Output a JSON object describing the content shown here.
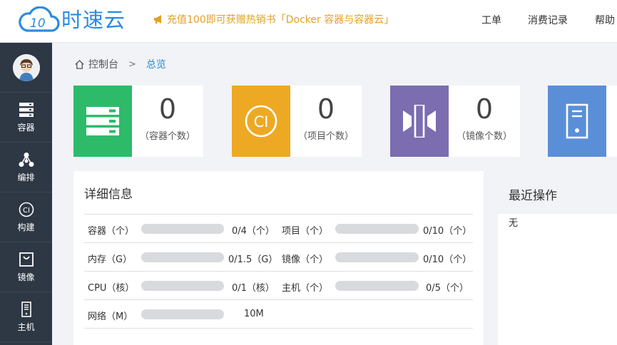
{
  "brand": {
    "name": "时速云"
  },
  "promo": {
    "text": "充值100即可获赠热销书「Docker 容器与容器云」"
  },
  "nav": {
    "items": [
      "工单",
      "消费记录",
      "帮助"
    ]
  },
  "sidebar": {
    "items": [
      {
        "label": "容器",
        "icon": "server-stack-icon"
      },
      {
        "label": "编排",
        "icon": "topology-icon"
      },
      {
        "label": "构建",
        "icon": "ci-icon"
      },
      {
        "label": "镜像",
        "icon": "image-bag-icon"
      },
      {
        "label": "主机",
        "icon": "host-icon"
      }
    ]
  },
  "breadcrumb": {
    "root": "控制台",
    "current": "总览"
  },
  "cards": [
    {
      "value": "0",
      "label": "（容器个数）",
      "color": "#2dbb6a",
      "icon": "server-stack-icon"
    },
    {
      "value": "0",
      "label": "（项目个数）",
      "color": "#eda923",
      "icon": "ci-icon"
    },
    {
      "value": "0",
      "label": "（镜像个数）",
      "color": "#7b6db0",
      "icon": "image-icon"
    },
    {
      "value": "",
      "label": "",
      "color": "#5a8fd8",
      "icon": "host-icon"
    }
  ],
  "details": {
    "title": "详细信息",
    "rows": [
      [
        {
          "label": "容器（个）",
          "value": "0/4（个）",
          "ratio": 0
        },
        {
          "label": "项目（个）",
          "value": "0/10（个）",
          "ratio": 0
        }
      ],
      [
        {
          "label": "内存（G）",
          "value": "0/1.5（G）",
          "ratio": 0
        },
        {
          "label": "镜像（个）",
          "value": "0/10（个）",
          "ratio": 0
        }
      ],
      [
        {
          "label": "CPU（核）",
          "value": "0/1（核）",
          "ratio": 0
        },
        {
          "label": "主机（个）",
          "value": "0/5（个）",
          "ratio": 0
        }
      ],
      [
        {
          "label": "网络（M）",
          "value": "10M",
          "ratio": 0
        }
      ]
    ]
  },
  "recent": {
    "title": "最近操作",
    "empty": "无"
  },
  "colors": {
    "accent": "#2a8be0",
    "promo": "#e2a028",
    "sidebar": "#2e3744"
  }
}
